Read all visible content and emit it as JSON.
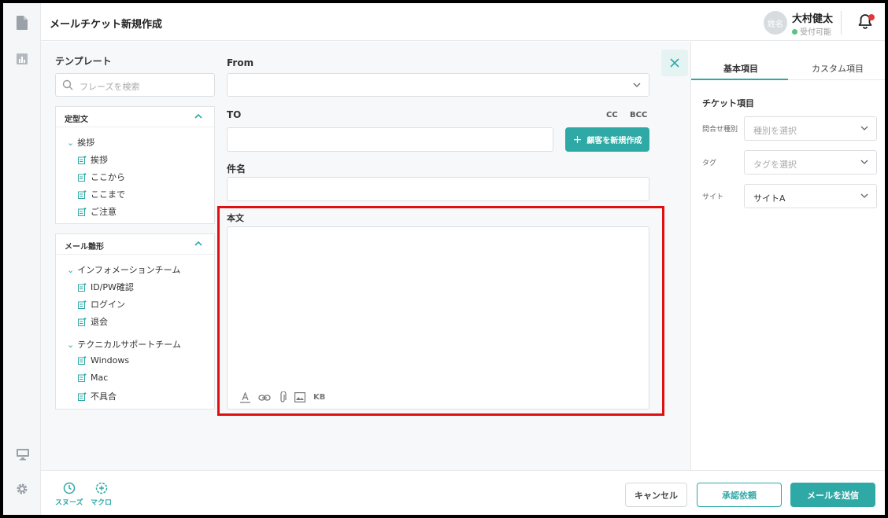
{
  "header": {
    "title": "メールチケット新規作成",
    "avatar_text": "姓名",
    "user_name": "大村健太",
    "user_status": "受付可能"
  },
  "template": {
    "label": "テンプレート",
    "search_placeholder": "フレーズを検索",
    "teikei": {
      "title": "定型文",
      "group": "挨拶",
      "items": [
        "挨拶",
        "ここから",
        "ここまで",
        "ご注意"
      ]
    },
    "mail_template": {
      "title": "メール雛形",
      "groups": [
        {
          "name": "インフォメーションチーム",
          "items": [
            "ID/PW確認",
            "ログイン",
            "退会"
          ]
        },
        {
          "name": "テクニカルサポートチーム",
          "items": [
            "Windows",
            "Mac",
            "不具合"
          ]
        }
      ]
    }
  },
  "form": {
    "from_label": "From",
    "to_label": "TO",
    "cc_label": "CC",
    "bcc_label": "BCC",
    "new_customer_label": "顧客を新規作成",
    "subject_label": "件名",
    "body_label": "本文",
    "toolbar_kb": "KB"
  },
  "right_panel": {
    "tabs": [
      "基本項目",
      "カスタム項目"
    ],
    "section_title": "チケット項目",
    "fields": [
      {
        "label": "問合せ種別",
        "value": "種別を選択",
        "is_placeholder": true
      },
      {
        "label": "タグ",
        "value": "タグを選択",
        "is_placeholder": true
      },
      {
        "label": "サイト",
        "value": "サイトA",
        "is_placeholder": false
      }
    ]
  },
  "footer": {
    "snooze_label": "スヌーズ",
    "macro_label": "マクロ",
    "cancel_label": "キャンセル",
    "approve_label": "承認依頼",
    "send_label": "メールを送信"
  },
  "colors": {
    "accent": "#2fa9a6",
    "highlight": "#e01010",
    "notification": "#e2363b",
    "online": "#55c47c"
  }
}
